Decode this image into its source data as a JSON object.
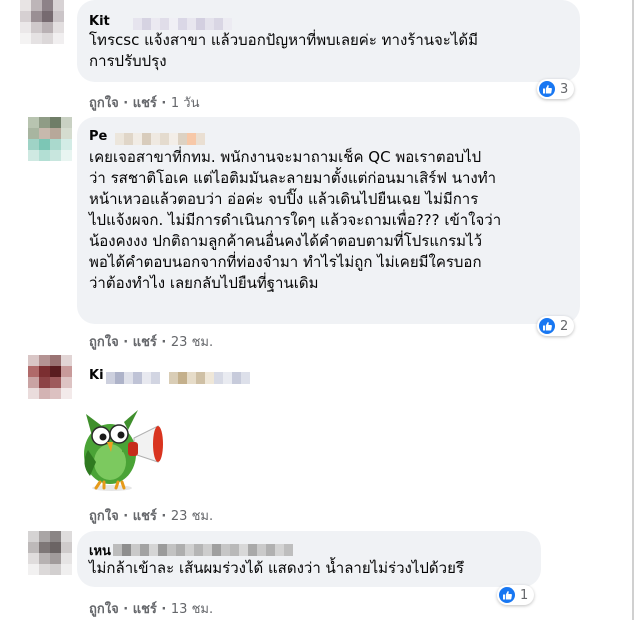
{
  "comments": [
    {
      "author": "Kit",
      "text": [
        "โทรcsc แจ้งสาขา แล้วบอกปัญหาที่พบเลยค่ะ ทางร้านจะได้มี",
        "การปรับปรุง"
      ],
      "like": "ถูกใจ",
      "share": "แชร์",
      "time": "1 วัน",
      "reactions": "3"
    },
    {
      "author": "Pe",
      "text": [
        "เคยเจอสาขาที่กทม. พนักงานจะมาถามเช็ค QC พอเราตอบไป",
        "ว่า รสชาติโอเค แต่ไอติมมันละลายมาตั้งแต่ก่อนมาเสิร์ฟ นางทำ",
        "หน้าเหวอแล้วตอบว่า อ่อค่ะ จบปิ๊ง แล้วเดินไปยืนเฉย ไม่มีการ",
        "ไปแจ้งผจก. ไม่มีการดำเนินการใดๆ แล้วจะถามเพื่อ??? เข้าใจว่า",
        "น้องคงงง ปกติถามลูกค้าคนอื่นคงได้คำตอบตามที่โปรแกรมไว้",
        "พอได้คำตอบนอกจากที่ท่องจำมา ทำไรไม่ถูก ไม่เคยมีใครบอก",
        "ว่าต้องทำไง เลยกลับไปยืนที่ฐานเดิม"
      ],
      "like": "ถูกใจ",
      "share": "แชร์",
      "time": "23 ชม.",
      "reactions": "2"
    },
    {
      "author": "Ki",
      "like": "ถูกใจ",
      "share": "แชร์",
      "time": "23 ชม."
    },
    {
      "author": "เหน",
      "text": [
        "ไม่กล้าเข้าละ เส้นผมร่วงได้ แสดงว่า น้ำลายไม่ร่วงไปด้วยรึ"
      ],
      "like": "ถูกใจ",
      "share": "แชร์",
      "time": "13 ชม.",
      "reactions": "1"
    }
  ],
  "colors": {
    "like_blue": "#1877f2",
    "bubble": "#f0f2f5",
    "meta": "#65676b"
  },
  "icons": {
    "reaction": "like-thumb-icon",
    "sticker": "owl-megaphone-sticker"
  }
}
